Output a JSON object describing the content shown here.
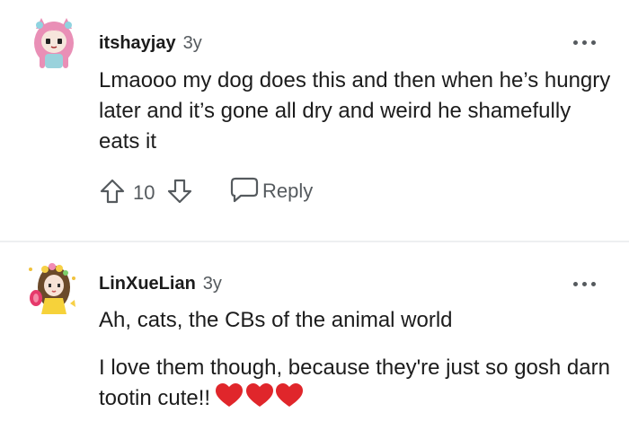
{
  "comments": [
    {
      "username": "itshayjay",
      "age": "3y",
      "body": [
        "Lmaooo my dog does this and then when he’s hungry later and it’s gone all dry and weird he shamefully eats it"
      ],
      "score": "10",
      "reply_label": "Reply",
      "avatar_icon": "avatar-pink-hair-icon"
    },
    {
      "username": "LinXueLian",
      "age": "3y",
      "body": [
        "Ah, cats, the CBs of the animal world",
        "I love them though, because they're just so gosh darn tootin cute!!"
      ],
      "emoji": [
        "❤️",
        "❤️",
        "❤️"
      ],
      "avatar_icon": "avatar-flower-crown-icon"
    }
  ],
  "colors": {
    "text": "#1c1c1c",
    "muted": "#555a5e",
    "heart": "#e0262b",
    "divider": "#edeff1"
  }
}
